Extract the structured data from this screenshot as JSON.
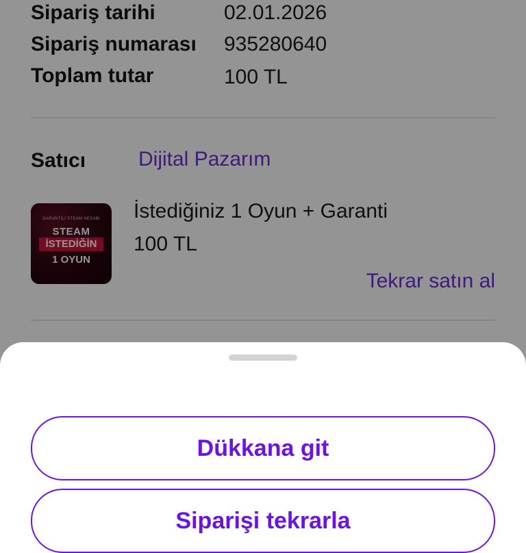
{
  "order": {
    "date_label": "Sipariş tarihi",
    "date_value": "02.01.2026",
    "number_label": "Sipariş numarası",
    "number_value": "935280640",
    "total_label": "Toplam tutar",
    "total_value": "100 TL"
  },
  "seller": {
    "label": "Satıcı",
    "name": "Dijital Pazarım"
  },
  "product": {
    "thumbnail": {
      "tagline": "GARANTİLİ STEAM HESABI",
      "line1": "STEAM",
      "line2": "İSTEDİĞİN",
      "line3": "1 OYUN"
    },
    "name": "İstediğiniz 1 Oyun + Garanti",
    "price": "100 TL",
    "rebuy_label": "Tekrar satın al"
  },
  "sheet": {
    "primary_button": "Dükkana git",
    "secondary_button": "Siparişi tekrarla"
  },
  "colors": {
    "accent": "#6b14e0",
    "link": "#6b2fd6",
    "scrim": "rgba(0,0,0,0.42)"
  }
}
